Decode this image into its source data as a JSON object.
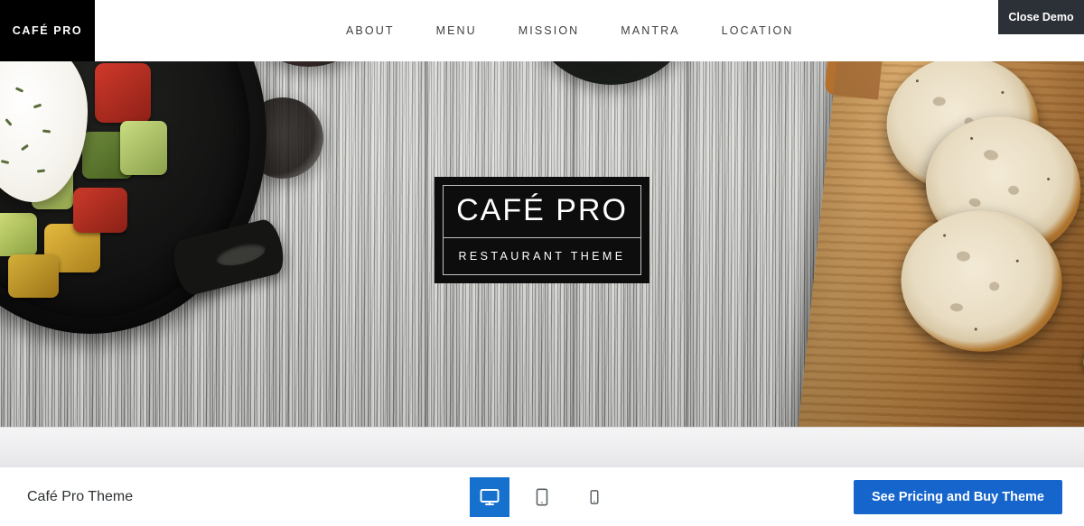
{
  "preview": {
    "site": {
      "brand": "CAFÉ PRO",
      "nav": [
        {
          "label": "ABOUT",
          "name": "nav-item-about"
        },
        {
          "label": "MENU",
          "name": "nav-item-menu"
        },
        {
          "label": "MISSION",
          "name": "nav-item-mission"
        },
        {
          "label": "MANTRA",
          "name": "nav-item-mantra"
        },
        {
          "label": "LOCATION",
          "name": "nav-item-location"
        }
      ],
      "hero": {
        "logo_title": "CAFÉ PRO",
        "logo_subtitle": "RESTAURANT THEME",
        "image_description": "Overhead photo of a cast-iron skillet of roasted vegetables with a poached egg on the left, seeded bread slices on a wooden cutting board on the right, set on weathered grey wood planks"
      }
    }
  },
  "overlay": {
    "close_demo_label": "Close Demo"
  },
  "toolbar": {
    "title": "Café Pro Theme",
    "devices": [
      {
        "label": "Desktop",
        "icon": "desktop-icon",
        "active": true
      },
      {
        "label": "Tablet",
        "icon": "tablet-icon",
        "active": false
      },
      {
        "label": "Mobile",
        "icon": "mobile-icon",
        "active": false
      }
    ],
    "buy_label": "See Pricing and Buy Theme"
  },
  "colors": {
    "accent_blue": "#1565cc",
    "active_device_blue": "#1571cd",
    "close_demo_dark": "#2c3138",
    "brand_black": "#000000"
  }
}
